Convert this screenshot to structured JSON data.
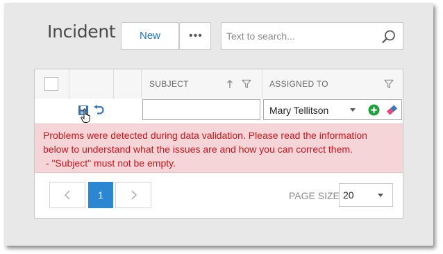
{
  "header": {
    "title": "Incident",
    "new_label": "New",
    "more_label": "•••",
    "search_placeholder": "Text to search..."
  },
  "grid": {
    "columns": [
      {
        "label": "SUBJECT"
      },
      {
        "label": "ASSIGNED TO"
      }
    ],
    "edit_row": {
      "subject_value": "",
      "assigned_to_value": "Mary Tellitson"
    },
    "validation": {
      "line1": "Problems were detected during data validation. Please read the information",
      "line2": "below to understand what the issues are and how you can correct them.",
      "line3": " - \"Subject\" must not be empty."
    }
  },
  "pager": {
    "current_page": "1",
    "page_size_label": "PAGE SIZE",
    "page_size_value": "20"
  },
  "colors": {
    "accent": "#2d86d2",
    "error_text": "#c4161c",
    "error_bg": "#f5d5d7",
    "add_icon": "#1ea03c"
  }
}
